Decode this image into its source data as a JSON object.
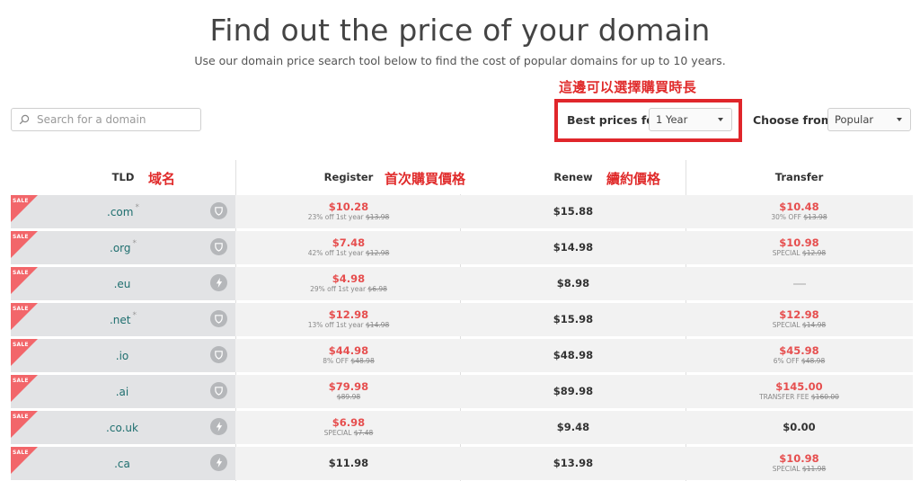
{
  "title": "Find out the price of your domain",
  "subtitle": "Use our domain price search tool below to find the cost of popular domains for up to 10 years.",
  "annotations": {
    "period": "這邊可以選擇購買時長",
    "tld": "域名",
    "register": "首次購買價格",
    "renew": "續約價格"
  },
  "search": {
    "placeholder": "Search for a domain"
  },
  "filters": {
    "best_prices_label": "Best prices for",
    "best_prices_value": "1 Year",
    "choose_from_label": "Choose from",
    "choose_from_value": "Popular"
  },
  "columns": {
    "tld": "TLD",
    "register": "Register",
    "renew": "Renew",
    "transfer": "Transfer"
  },
  "sale_label": "SALE",
  "rows": [
    {
      "tld": ".com",
      "star": "*",
      "badge": "shield-icon",
      "register": {
        "price": "$10.28",
        "red": true,
        "note": "23% off 1st year ",
        "old": "$13.98"
      },
      "renew": "$15.88",
      "transfer": {
        "price": "$10.48",
        "red": true,
        "note": "30% OFF ",
        "old": "$13.98"
      }
    },
    {
      "tld": ".org",
      "star": "*",
      "badge": "shield-icon",
      "register": {
        "price": "$7.48",
        "red": true,
        "note": "42% off 1st year ",
        "old": "$12.98"
      },
      "renew": "$14.98",
      "transfer": {
        "price": "$10.98",
        "red": true,
        "note": "SPECIAL ",
        "old": "$12.98"
      }
    },
    {
      "tld": ".eu",
      "star": "",
      "badge": "lightning-icon",
      "register": {
        "price": "$4.98",
        "red": true,
        "note": "29% off 1st year ",
        "old": "$6.98"
      },
      "renew": "$8.98",
      "transfer": null
    },
    {
      "tld": ".net",
      "star": "*",
      "badge": "shield-icon",
      "register": {
        "price": "$12.98",
        "red": true,
        "note": "13% off 1st year ",
        "old": "$14.98"
      },
      "renew": "$15.98",
      "transfer": {
        "price": "$12.98",
        "red": true,
        "note": "SPECIAL ",
        "old": "$14.98"
      }
    },
    {
      "tld": ".io",
      "star": "",
      "badge": "shield-icon",
      "register": {
        "price": "$44.98",
        "red": true,
        "note": "8% OFF ",
        "old": "$48.98"
      },
      "renew": "$48.98",
      "transfer": {
        "price": "$45.98",
        "red": true,
        "note": "6% OFF ",
        "old": "$48.98"
      }
    },
    {
      "tld": ".ai",
      "star": "",
      "badge": "shield-icon",
      "register": {
        "price": "$79.98",
        "red": true,
        "note": "",
        "old": "$89.98"
      },
      "renew": "$89.98",
      "transfer": {
        "price": "$145.00",
        "red": true,
        "note": "TRANSFER FEE ",
        "old": "$160.00"
      }
    },
    {
      "tld": ".co.uk",
      "star": "",
      "badge": "lightning-icon",
      "register": {
        "price": "$6.98",
        "red": true,
        "note": "SPECIAL ",
        "old": "$7.48"
      },
      "renew": "$9.48",
      "transfer": {
        "price": "$0.00",
        "red": false,
        "note": "",
        "old": ""
      }
    },
    {
      "tld": ".ca",
      "star": "",
      "badge": "lightning-icon",
      "register": {
        "price": "$11.98",
        "red": false,
        "note": "",
        "old": ""
      },
      "renew": "$13.98",
      "transfer": {
        "price": "$10.98",
        "red": true,
        "note": "SPECIAL ",
        "old": "$11.98"
      }
    }
  ]
}
